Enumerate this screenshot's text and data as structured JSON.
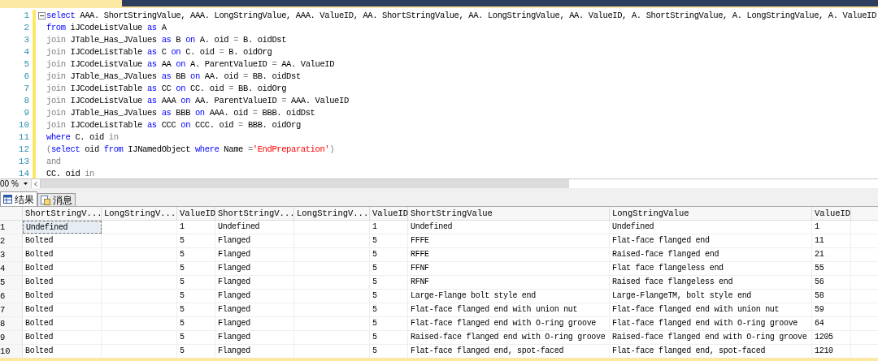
{
  "editor": {
    "lines": [
      {
        "number": "1",
        "segments": [
          {
            "text": "select",
            "kind": "keyword"
          },
          {
            "text": " AAA. ShortStringValue, AAA. LongStringValue, AAA. ValueID, AA. ShortStringValue, AA. LongStringValue, AA. ValueID, A. ShortStringValue, A. LongStringValue, A. ValueID",
            "kind": "plain"
          }
        ]
      },
      {
        "number": "2",
        "segments": [
          {
            "text": "from",
            "kind": "keyword"
          },
          {
            "text": " iJCodeListValue ",
            "kind": "plain"
          },
          {
            "text": "as",
            "kind": "keyword"
          },
          {
            "text": " A",
            "kind": "plain"
          }
        ]
      },
      {
        "number": "3",
        "segments": [
          {
            "text": "join",
            "kind": "operator"
          },
          {
            "text": " JTable_Has_JValues ",
            "kind": "plain"
          },
          {
            "text": "as",
            "kind": "keyword"
          },
          {
            "text": " B ",
            "kind": "plain"
          },
          {
            "text": "on",
            "kind": "keyword"
          },
          {
            "text": " A. oid ",
            "kind": "plain"
          },
          {
            "text": "=",
            "kind": "operator"
          },
          {
            "text": " B. oidDst",
            "kind": "plain"
          }
        ]
      },
      {
        "number": "4",
        "segments": [
          {
            "text": "join",
            "kind": "operator"
          },
          {
            "text": " IJCodeListTable ",
            "kind": "plain"
          },
          {
            "text": "as",
            "kind": "keyword"
          },
          {
            "text": " C ",
            "kind": "plain"
          },
          {
            "text": "on",
            "kind": "keyword"
          },
          {
            "text": " C. oid ",
            "kind": "plain"
          },
          {
            "text": "=",
            "kind": "operator"
          },
          {
            "text": " B. oidOrg",
            "kind": "plain"
          }
        ]
      },
      {
        "number": "5",
        "segments": [
          {
            "text": "join",
            "kind": "operator"
          },
          {
            "text": " IJCodeListValue ",
            "kind": "plain"
          },
          {
            "text": "as",
            "kind": "keyword"
          },
          {
            "text": " AA ",
            "kind": "plain"
          },
          {
            "text": "on",
            "kind": "keyword"
          },
          {
            "text": " A. ParentValueID ",
            "kind": "plain"
          },
          {
            "text": "=",
            "kind": "operator"
          },
          {
            "text": " AA. ValueID",
            "kind": "plain"
          }
        ]
      },
      {
        "number": "6",
        "segments": [
          {
            "text": "join",
            "kind": "operator"
          },
          {
            "text": " JTable_Has_JValues ",
            "kind": "plain"
          },
          {
            "text": "as",
            "kind": "keyword"
          },
          {
            "text": " BB ",
            "kind": "plain"
          },
          {
            "text": "on",
            "kind": "keyword"
          },
          {
            "text": " AA. oid ",
            "kind": "plain"
          },
          {
            "text": "=",
            "kind": "operator"
          },
          {
            "text": " BB. oidDst",
            "kind": "plain"
          }
        ]
      },
      {
        "number": "7",
        "segments": [
          {
            "text": "join",
            "kind": "operator"
          },
          {
            "text": " IJCodeListTable ",
            "kind": "plain"
          },
          {
            "text": "as",
            "kind": "keyword"
          },
          {
            "text": " CC ",
            "kind": "plain"
          },
          {
            "text": "on",
            "kind": "keyword"
          },
          {
            "text": " CC. oid ",
            "kind": "plain"
          },
          {
            "text": "=",
            "kind": "operator"
          },
          {
            "text": " BB. oidOrg",
            "kind": "plain"
          }
        ]
      },
      {
        "number": "8",
        "segments": [
          {
            "text": "join",
            "kind": "operator"
          },
          {
            "text": " IJCodeListValue ",
            "kind": "plain"
          },
          {
            "text": "as",
            "kind": "keyword"
          },
          {
            "text": " AAA ",
            "kind": "plain"
          },
          {
            "text": "on",
            "kind": "keyword"
          },
          {
            "text": " AA. ParentValueID ",
            "kind": "plain"
          },
          {
            "text": "=",
            "kind": "operator"
          },
          {
            "text": " AAA. ValueID",
            "kind": "plain"
          }
        ]
      },
      {
        "number": "9",
        "segments": [
          {
            "text": "join",
            "kind": "operator"
          },
          {
            "text": " JTable_Has_JValues ",
            "kind": "plain"
          },
          {
            "text": "as",
            "kind": "keyword"
          },
          {
            "text": " BBB ",
            "kind": "plain"
          },
          {
            "text": "on",
            "kind": "keyword"
          },
          {
            "text": " AAA. oid ",
            "kind": "plain"
          },
          {
            "text": "=",
            "kind": "operator"
          },
          {
            "text": " BBB. oidDst",
            "kind": "plain"
          }
        ]
      },
      {
        "number": "10",
        "segments": [
          {
            "text": "join",
            "kind": "operator"
          },
          {
            "text": " IJCodeListTable ",
            "kind": "plain"
          },
          {
            "text": "as",
            "kind": "keyword"
          },
          {
            "text": " CCC ",
            "kind": "plain"
          },
          {
            "text": "on",
            "kind": "keyword"
          },
          {
            "text": " CCC. oid ",
            "kind": "plain"
          },
          {
            "text": "=",
            "kind": "operator"
          },
          {
            "text": " BBB. oidOrg",
            "kind": "plain"
          }
        ]
      },
      {
        "number": "11",
        "segments": [
          {
            "text": "where",
            "kind": "keyword"
          },
          {
            "text": " C. oid ",
            "kind": "plain"
          },
          {
            "text": "in",
            "kind": "operator"
          }
        ]
      },
      {
        "number": "12",
        "segments": [
          {
            "text": "(",
            "kind": "operator"
          },
          {
            "text": "select",
            "kind": "keyword"
          },
          {
            "text": " oid ",
            "kind": "plain"
          },
          {
            "text": "from",
            "kind": "keyword"
          },
          {
            "text": " IJNamedObject ",
            "kind": "plain"
          },
          {
            "text": "where",
            "kind": "keyword"
          },
          {
            "text": " Name ",
            "kind": "plain"
          },
          {
            "text": "=",
            "kind": "operator"
          },
          {
            "text": "'EndPreparation'",
            "kind": "string"
          },
          {
            "text": ")",
            "kind": "operator"
          }
        ]
      },
      {
        "number": "13",
        "segments": [
          {
            "text": "and",
            "kind": "operator"
          }
        ]
      },
      {
        "number": "14",
        "segments": [
          {
            "text": "CC. oid ",
            "kind": "plain"
          },
          {
            "text": "in",
            "kind": "operator"
          }
        ]
      }
    ],
    "zoom": "00 %"
  },
  "result_tabs": [
    {
      "label": "结果",
      "kind": "grid",
      "selected": true
    },
    {
      "label": "消息",
      "kind": "messages",
      "selected": false
    }
  ],
  "table": {
    "columns": [
      "ShortStringV...",
      "LongStringV...",
      "ValueID",
      "ShortStringV...",
      "LongStringV...",
      "ValueID",
      "ShortStringValue",
      "LongStringValue",
      "ValueID"
    ],
    "rows": [
      {
        "number": "1",
        "cells": [
          {
            "text": "Undefined",
            "selected": true
          },
          {
            "selected": false
          },
          {
            "text": "1",
            "selected": false
          },
          {
            "text": "Undefined",
            "selected": false
          },
          {
            "selected": false
          },
          {
            "text": "1",
            "selected": false
          },
          {
            "text": "Undefined",
            "selected": false
          },
          {
            "text": "Undefined",
            "selected": false
          },
          {
            "text": "1",
            "selected": false
          }
        ]
      },
      {
        "number": "2",
        "cells": [
          {
            "text": "Bolted",
            "selected": false
          },
          {
            "selected": false
          },
          {
            "text": "5",
            "selected": false
          },
          {
            "text": "Flanged",
            "selected": false
          },
          {
            "selected": false
          },
          {
            "text": "5",
            "selected": false
          },
          {
            "text": "FFFE",
            "selected": false
          },
          {
            "text": "Flat-face flanged end",
            "selected": false
          },
          {
            "text": "11",
            "selected": false
          }
        ]
      },
      {
        "number": "3",
        "cells": [
          {
            "text": "Bolted",
            "selected": false
          },
          {
            "selected": false
          },
          {
            "text": "5",
            "selected": false
          },
          {
            "text": "Flanged",
            "selected": false
          },
          {
            "selected": false
          },
          {
            "text": "5",
            "selected": false
          },
          {
            "text": "RFFE",
            "selected": false
          },
          {
            "text": "Raised-face flanged end",
            "selected": false
          },
          {
            "text": "21",
            "selected": false
          }
        ]
      },
      {
        "number": "4",
        "cells": [
          {
            "text": "Bolted",
            "selected": false
          },
          {
            "selected": false
          },
          {
            "text": "5",
            "selected": false
          },
          {
            "text": "Flanged",
            "selected": false
          },
          {
            "selected": false
          },
          {
            "text": "5",
            "selected": false
          },
          {
            "text": "FFNF",
            "selected": false
          },
          {
            "text": "Flat face flangeless end",
            "selected": false
          },
          {
            "text": "55",
            "selected": false
          }
        ]
      },
      {
        "number": "5",
        "cells": [
          {
            "text": "Bolted",
            "selected": false
          },
          {
            "selected": false
          },
          {
            "text": "5",
            "selected": false
          },
          {
            "text": "Flanged",
            "selected": false
          },
          {
            "selected": false
          },
          {
            "text": "5",
            "selected": false
          },
          {
            "text": "RFNF",
            "selected": false
          },
          {
            "text": "Raised face flangeless end",
            "selected": false
          },
          {
            "text": "56",
            "selected": false
          }
        ]
      },
      {
        "number": "6",
        "cells": [
          {
            "text": "Bolted",
            "selected": false
          },
          {
            "selected": false
          },
          {
            "text": "5",
            "selected": false
          },
          {
            "text": "Flanged",
            "selected": false
          },
          {
            "selected": false
          },
          {
            "text": "5",
            "selected": false
          },
          {
            "text": "Large-Flange bolt style end",
            "selected": false
          },
          {
            "text": "Large-FlangeTM, bolt style end",
            "selected": false
          },
          {
            "text": "58",
            "selected": false
          }
        ]
      },
      {
        "number": "7",
        "cells": [
          {
            "text": "Bolted",
            "selected": false
          },
          {
            "selected": false
          },
          {
            "text": "5",
            "selected": false
          },
          {
            "text": "Flanged",
            "selected": false
          },
          {
            "selected": false
          },
          {
            "text": "5",
            "selected": false
          },
          {
            "text": "Flat-face flanged end with union nut",
            "selected": false
          },
          {
            "text": "Flat-face flanged end with union nut",
            "selected": false
          },
          {
            "text": "59",
            "selected": false
          }
        ]
      },
      {
        "number": "8",
        "cells": [
          {
            "text": "Bolted",
            "selected": false
          },
          {
            "selected": false
          },
          {
            "text": "5",
            "selected": false
          },
          {
            "text": "Flanged",
            "selected": false
          },
          {
            "selected": false
          },
          {
            "text": "5",
            "selected": false
          },
          {
            "text": "Flat-face flanged end with O-ring groove",
            "selected": false
          },
          {
            "text": "Flat-face flanged end with O-ring groove",
            "selected": false
          },
          {
            "text": "64",
            "selected": false
          }
        ]
      },
      {
        "number": "9",
        "cells": [
          {
            "text": "Bolted",
            "selected": false
          },
          {
            "selected": false
          },
          {
            "text": "5",
            "selected": false
          },
          {
            "text": "Flanged",
            "selected": false
          },
          {
            "selected": false
          },
          {
            "text": "5",
            "selected": false
          },
          {
            "text": "Raised-face flanged end with O-ring groove",
            "selected": false
          },
          {
            "text": "Raised-face flanged end with O-ring groove",
            "selected": false
          },
          {
            "text": "1205",
            "selected": false
          }
        ]
      },
      {
        "number": "10",
        "cells": [
          {
            "text": "Bolted",
            "selected": false
          },
          {
            "selected": false
          },
          {
            "text": "5",
            "selected": false
          },
          {
            "text": "Flanged",
            "selected": false
          },
          {
            "selected": false
          },
          {
            "text": "5",
            "selected": false
          },
          {
            "text": "Flat-face flanged end, spot-faced",
            "selected": false
          },
          {
            "text": "Flat-face flanged end, spot-faced",
            "selected": false
          },
          {
            "text": "1210",
            "selected": false
          }
        ]
      }
    ]
  }
}
